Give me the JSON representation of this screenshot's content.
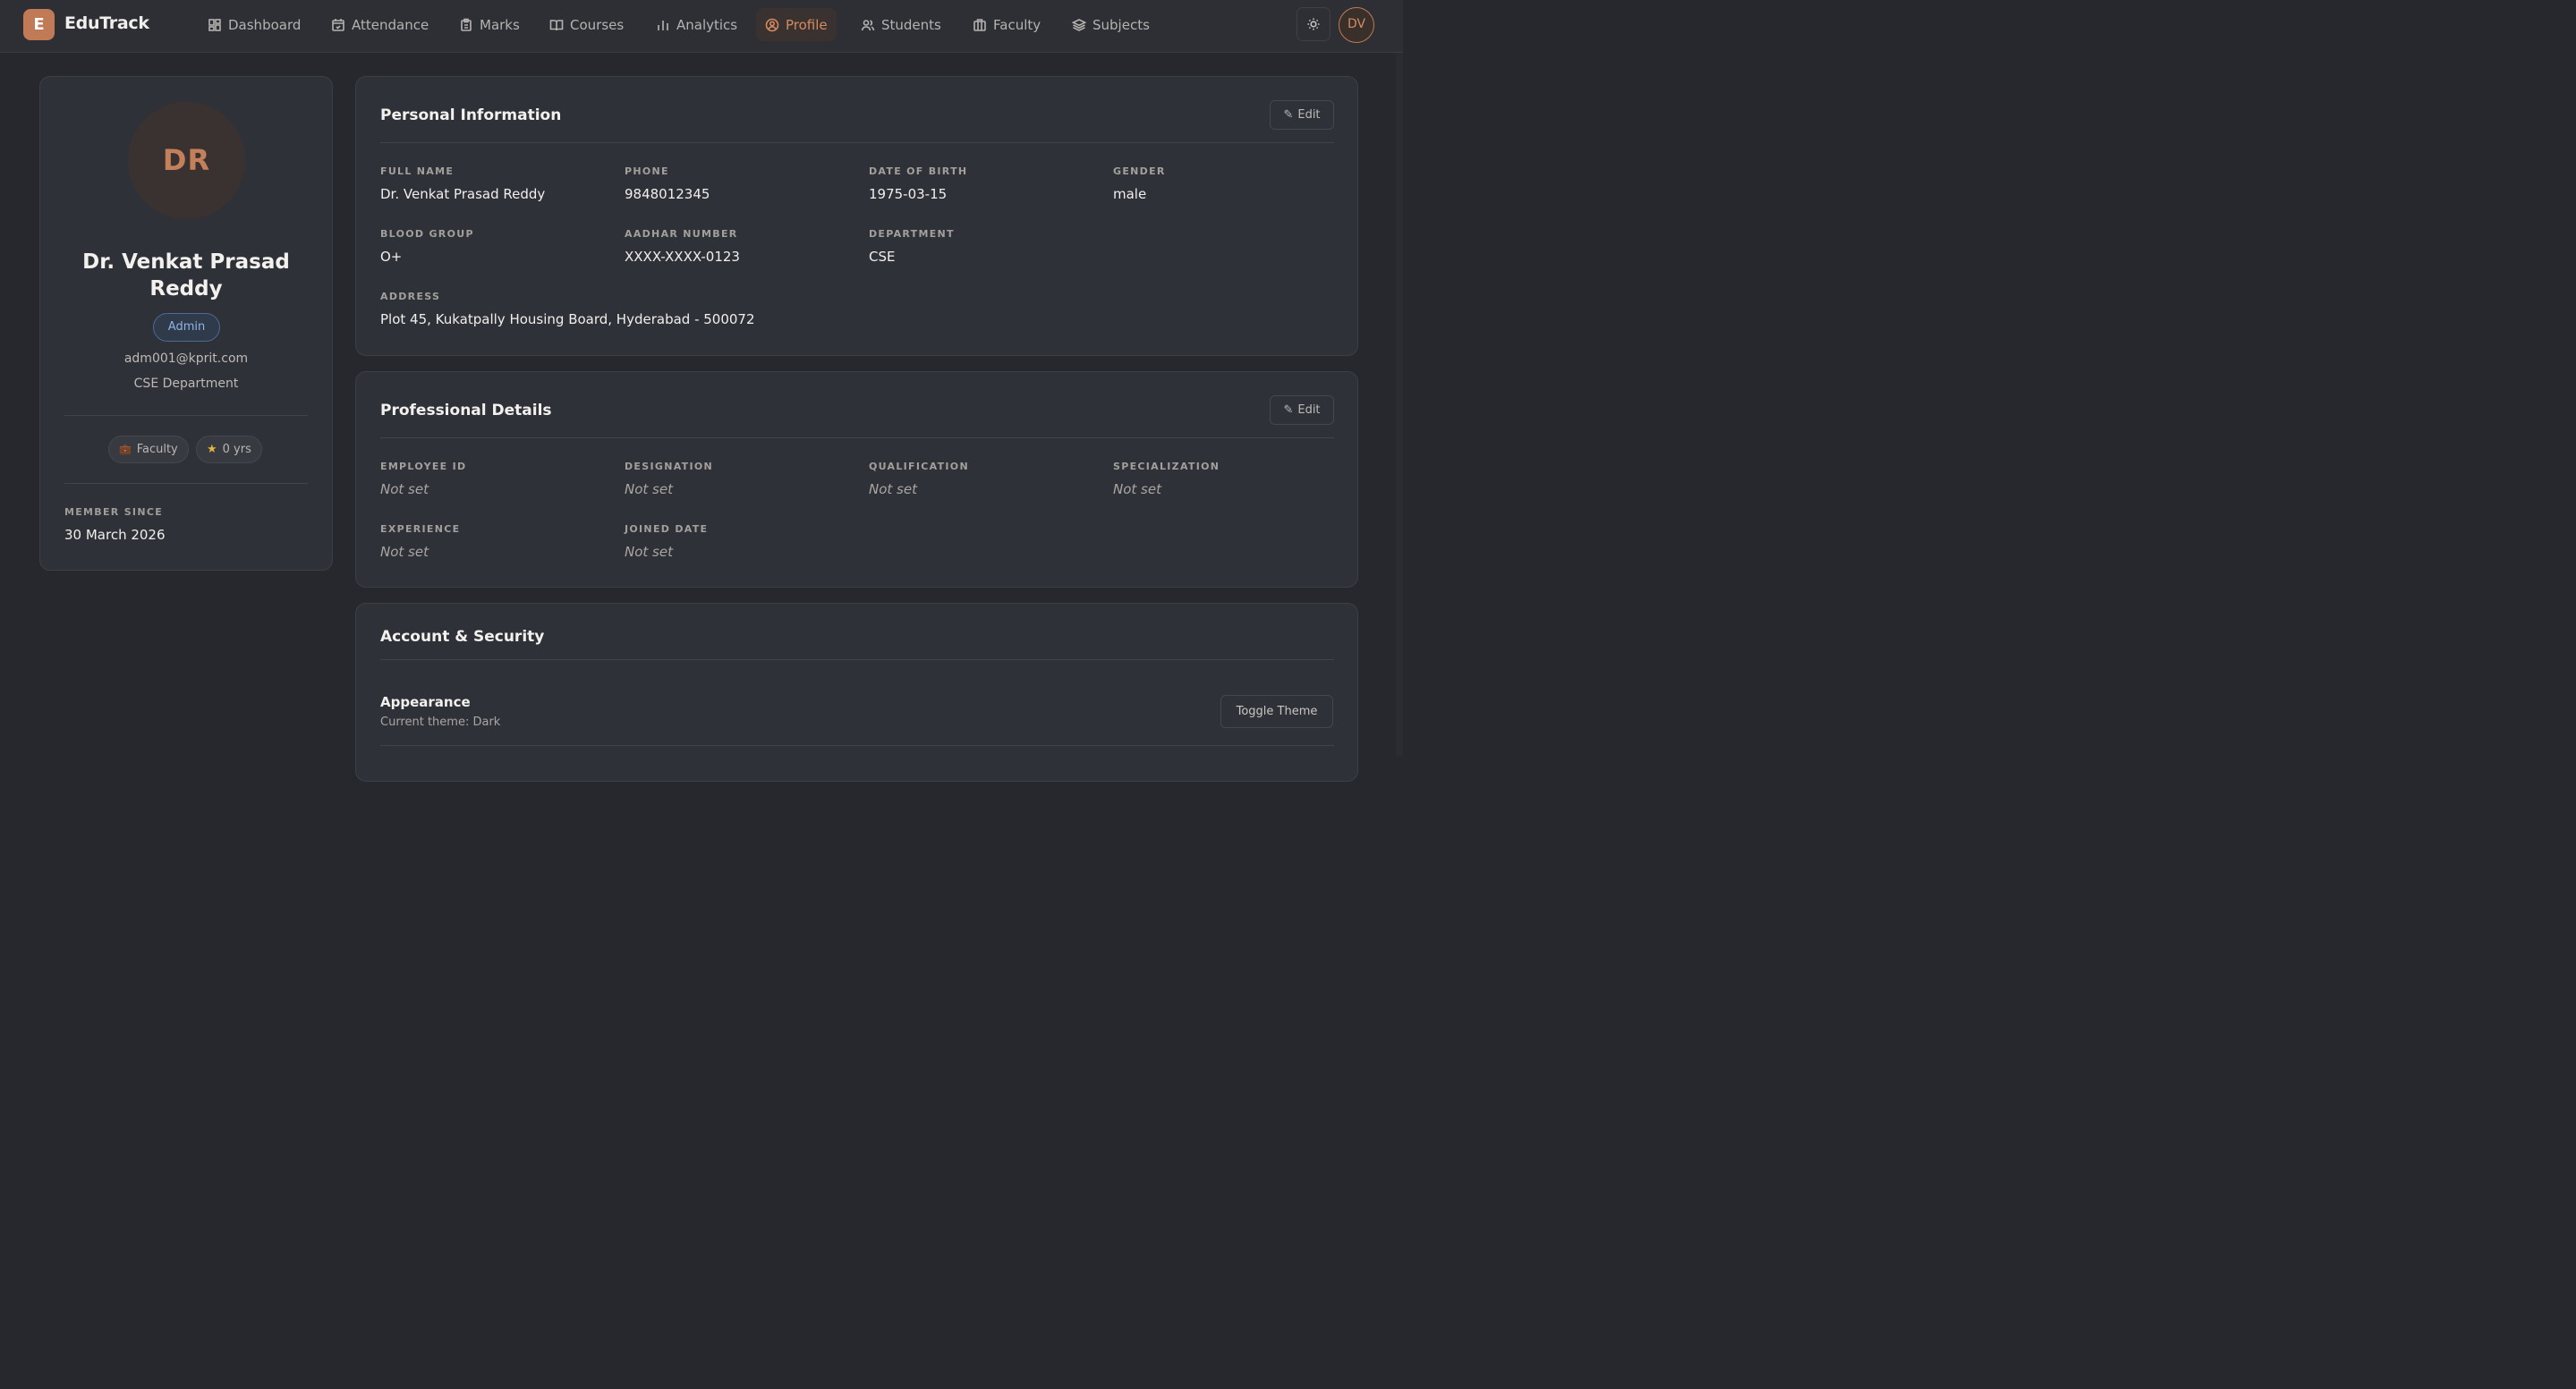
{
  "brand": {
    "logo_letter": "E",
    "name": "EduTrack",
    "accent": "#c07a55"
  },
  "nav": {
    "items": [
      {
        "label": "Dashboard",
        "icon": "dashboard-icon"
      },
      {
        "label": "Attendance",
        "icon": "calendar-check-icon"
      },
      {
        "label": "Marks",
        "icon": "clipboard-icon"
      },
      {
        "label": "Courses",
        "icon": "book-open-icon"
      },
      {
        "label": "Analytics",
        "icon": "bar-chart-icon"
      },
      {
        "label": "Profile",
        "icon": "user-circle-icon",
        "active": true
      },
      {
        "label": "Students",
        "icon": "users-icon"
      },
      {
        "label": "Faculty",
        "icon": "building-icon"
      },
      {
        "label": "Subjects",
        "icon": "layers-icon"
      }
    ],
    "theme_icon": "sun-icon",
    "user_initials": "DV"
  },
  "profile": {
    "initials": "DR",
    "name": "Dr. Venkat Prasad Reddy",
    "role": "Admin",
    "email": "adm001@kprit.com",
    "department": "CSE Department",
    "chips": [
      {
        "icon": "briefcase-icon",
        "label": "Faculty"
      },
      {
        "icon": "star-icon",
        "label": "0 yrs"
      }
    ],
    "member_since_label": "MEMBER SINCE",
    "member_since": "30 March 2026"
  },
  "personal": {
    "title": "Personal Information",
    "edit_label": "Edit",
    "fields": {
      "full_name": {
        "label": "FULL NAME",
        "value": "Dr. Venkat Prasad Reddy"
      },
      "phone": {
        "label": "PHONE",
        "value": "9848012345"
      },
      "dob": {
        "label": "DATE OF BIRTH",
        "value": "1975-03-15"
      },
      "gender": {
        "label": "GENDER",
        "value": "male"
      },
      "blood_group": {
        "label": "BLOOD GROUP",
        "value": "O+"
      },
      "aadhar": {
        "label": "AADHAR NUMBER",
        "value": "XXXX-XXXX-0123"
      },
      "department": {
        "label": "DEPARTMENT",
        "value": "CSE"
      },
      "address": {
        "label": "ADDRESS",
        "value": "Plot 45, Kukatpally Housing Board, Hyderabad - 500072"
      }
    }
  },
  "professional": {
    "title": "Professional Details",
    "edit_label": "Edit",
    "fields": {
      "employee_id": {
        "label": "EMPLOYEE ID",
        "value": "Not set"
      },
      "designation": {
        "label": "DESIGNATION",
        "value": "Not set"
      },
      "qualification": {
        "label": "QUALIFICATION",
        "value": "Not set"
      },
      "specialization": {
        "label": "SPECIALIZATION",
        "value": "Not set"
      },
      "experience": {
        "label": "EXPERIENCE",
        "value": "Not set"
      },
      "joined_date": {
        "label": "JOINED DATE",
        "value": "Not set"
      }
    }
  },
  "account": {
    "title": "Account & Security",
    "appearance_title": "Appearance",
    "appearance_sub": "Current theme: Dark",
    "toggle_label": "Toggle Theme"
  }
}
